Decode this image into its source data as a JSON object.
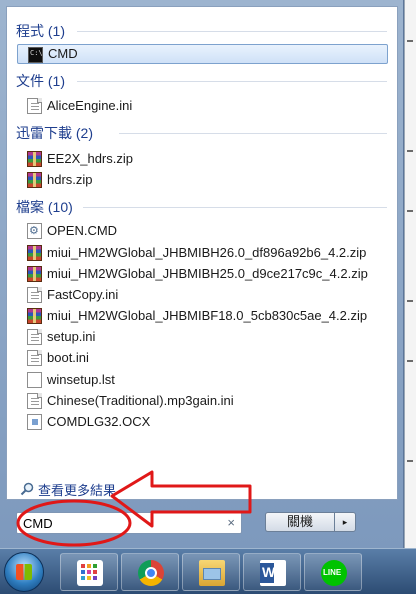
{
  "groups": [
    {
      "header": "程式 (1)",
      "items": [
        {
          "label": "CMD",
          "icon": "cmd-icon",
          "selected": true
        }
      ]
    },
    {
      "header": "文件 (1)",
      "items": [
        {
          "label": "AliceEngine.ini",
          "icon": "ini-file-icon"
        }
      ]
    },
    {
      "header": "迅雷下載 (2)",
      "items": [
        {
          "label": "EE2X_hdrs.zip",
          "icon": "winrar-archive-icon"
        },
        {
          "label": "hdrs.zip",
          "icon": "winrar-archive-icon"
        }
      ]
    },
    {
      "header": "檔案 (10)",
      "items": [
        {
          "label": "OPEN.CMD",
          "icon": "cmd-script-icon"
        },
        {
          "label": "miui_HM2WGlobal_JHBMIBH26.0_df896a92b6_4.2.zip",
          "icon": "winrar-archive-icon"
        },
        {
          "label": "miui_HM2WGlobal_JHBMIBH25.0_d9ce217c9c_4.2.zip",
          "icon": "winrar-archive-icon"
        },
        {
          "label": "FastCopy.ini",
          "icon": "ini-file-icon"
        },
        {
          "label": "miui_HM2WGlobal_JHBMIBF18.0_5cb830c5ae_4.2.zip",
          "icon": "winrar-archive-icon"
        },
        {
          "label": "setup.ini",
          "icon": "ini-file-icon"
        },
        {
          "label": "boot.ini",
          "icon": "ini-file-icon"
        },
        {
          "label": "winsetup.lst",
          "icon": "text-file-icon"
        },
        {
          "label": "Chinese(Traditional).mp3gain.ini",
          "icon": "ini-file-icon"
        },
        {
          "label": "COMDLG32.OCX",
          "icon": "ocx-file-icon"
        }
      ]
    }
  ],
  "see_more": "查看更多結果",
  "search": {
    "value": "CMD",
    "clear": "×"
  },
  "shutdown": {
    "label": "關機",
    "arrow": "▸"
  },
  "taskbar": {
    "apps": [
      "app-grid-icon",
      "chrome-icon",
      "file-explorer-icon",
      "word-icon",
      "line-icon"
    ]
  },
  "annotation": {
    "color": "#e01818"
  }
}
